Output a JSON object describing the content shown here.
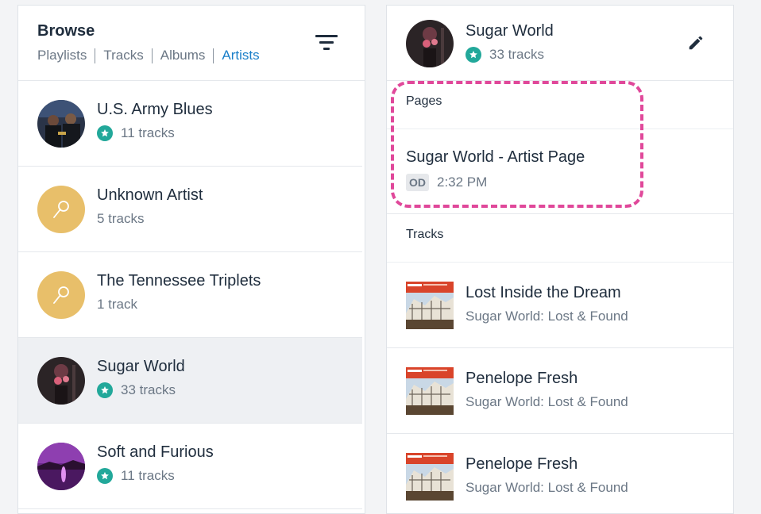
{
  "browse": {
    "title": "Browse",
    "nav": [
      {
        "label": "Playlists",
        "active": false
      },
      {
        "label": "Tracks",
        "active": false
      },
      {
        "label": "Albums",
        "active": false
      },
      {
        "label": "Artists",
        "active": true
      }
    ],
    "filter_icon": "filter-icon"
  },
  "artists": [
    {
      "name": "U.S. Army Blues",
      "count": "11 tracks",
      "starred": true,
      "avatar": "photo-band"
    },
    {
      "name": "Unknown Artist",
      "count": "5 tracks",
      "starred": false,
      "avatar": "microphone-icon"
    },
    {
      "name": "The Tennessee Triplets",
      "count": "1 track",
      "starred": false,
      "avatar": "microphone-icon"
    },
    {
      "name": "Sugar World",
      "count": "33 tracks",
      "starred": true,
      "selected": true,
      "avatar": "photo-performer"
    },
    {
      "name": "Soft and Furious",
      "count": "11 tracks",
      "starred": true,
      "avatar": "photo-sunset"
    }
  ],
  "detail": {
    "title": "Sugar World",
    "count": "33 tracks",
    "edit_icon": "pencil-icon",
    "pages_label": "Pages",
    "page": {
      "title": "Sugar World - Artist Page",
      "badge": "OD",
      "time": "2:32 PM"
    },
    "tracks_label": "Tracks",
    "tracks": [
      {
        "title": "Lost Inside the Dream",
        "album": "Sugar World: Lost & Found"
      },
      {
        "title": "Penelope Fresh",
        "album": "Sugar World: Lost & Found"
      },
      {
        "title": "Penelope Fresh",
        "album": "Sugar World: Lost & Found"
      }
    ]
  },
  "colors": {
    "accent": "#1a7fc9",
    "star_badge": "#22a89a",
    "placeholder_avatar": "#e8bf6a",
    "highlight": "#e0489a",
    "selected_row": "#eef0f3"
  }
}
